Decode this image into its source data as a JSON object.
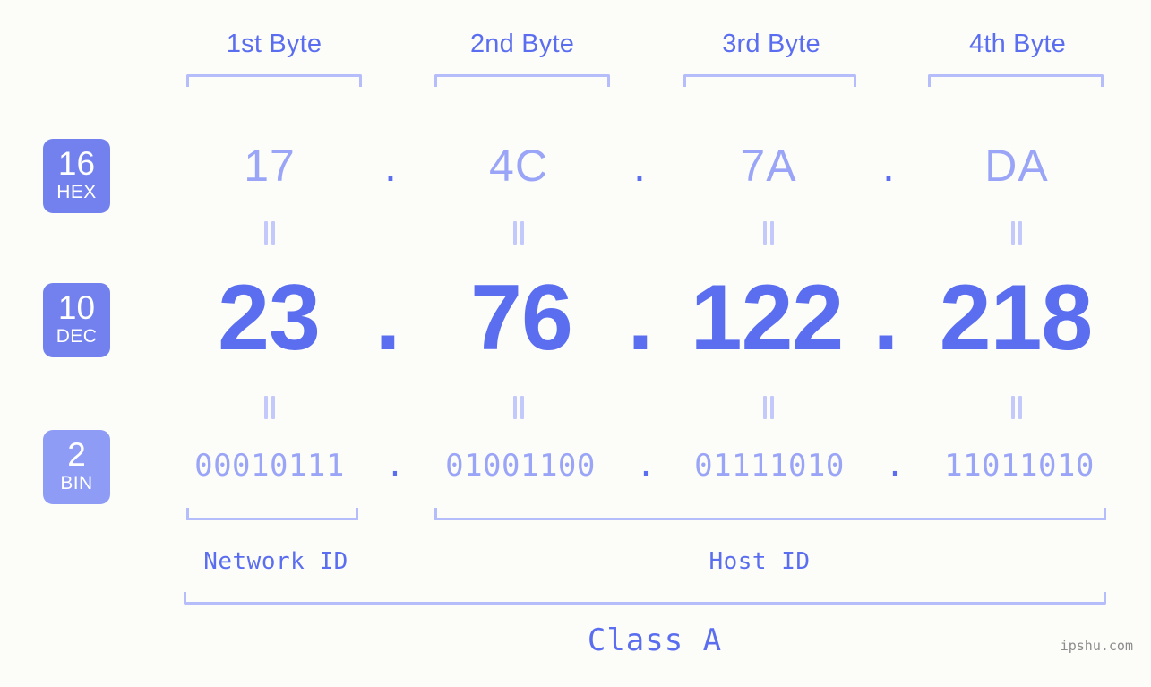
{
  "page": {
    "background_color": "#fcfdf9",
    "accent_color": "#5b6ef0",
    "accent_light_color": "#9aa5f7",
    "bracket_color": "#b6bdfb",
    "badge_color": "#7381ee",
    "badge_light_color": "#8e9cf5"
  },
  "byte_headers": [
    {
      "label": "1st Byte"
    },
    {
      "label": "2nd Byte"
    },
    {
      "label": "3rd Byte"
    },
    {
      "label": "4th Byte"
    }
  ],
  "bases": [
    {
      "number": "16",
      "name": "HEX"
    },
    {
      "number": "10",
      "name": "DEC"
    },
    {
      "number": "2",
      "name": "BIN"
    }
  ],
  "rows": {
    "hex": {
      "values": [
        "17",
        "4C",
        "7A",
        "DA"
      ],
      "separator": "."
    },
    "dec": {
      "values": [
        "23",
        "76",
        "122",
        "218"
      ],
      "separator": "."
    },
    "bin": {
      "values": [
        "00010111",
        "01001100",
        "01111010",
        "11011010"
      ],
      "separator": "."
    }
  },
  "equals_symbol": "=",
  "segments": {
    "network_id": "Network ID",
    "host_id": "Host ID"
  },
  "class_label": "Class A",
  "watermark": "ipshu.com"
}
